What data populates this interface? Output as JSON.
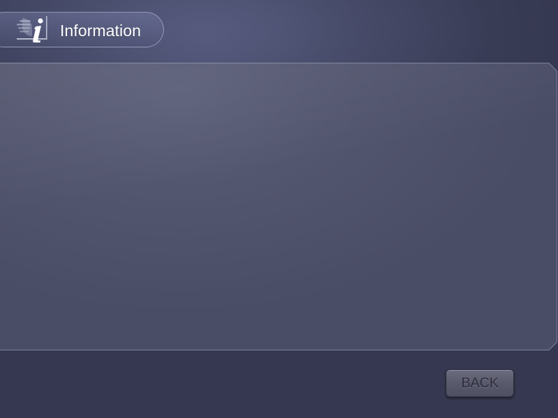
{
  "header": {
    "title": "Information",
    "icon": "info-icon"
  },
  "content": {
    "text": ""
  },
  "footer": {
    "back_label": "BACK"
  },
  "colors": {
    "background": "#3e425d",
    "panel": "#55586f",
    "title_text": "#ffffff",
    "button": "#5d5d70",
    "button_text": "#2e2e3c"
  }
}
